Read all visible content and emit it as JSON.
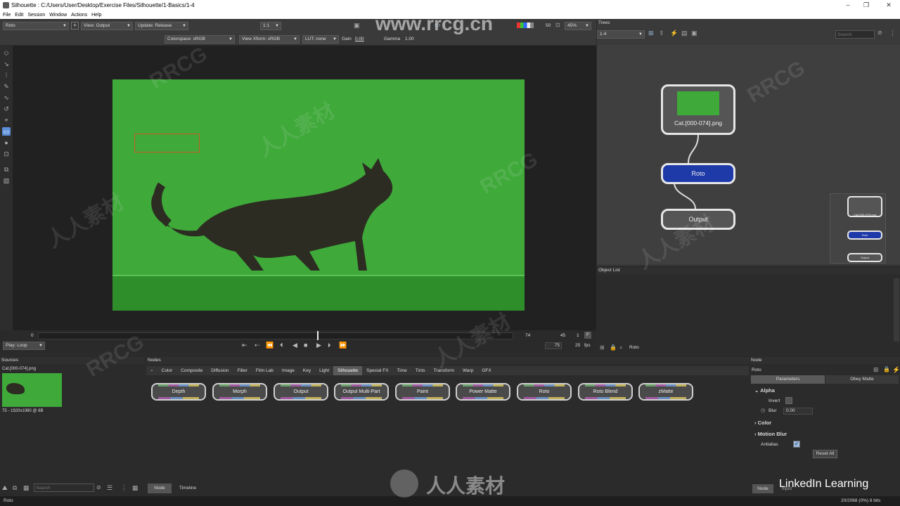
{
  "window": {
    "title": "Silhouette : C:/Users/User/Desktop/Exercise Files/Silhouette/1-Basics/1-4",
    "minimize": "–",
    "maximize": "❐",
    "close": "✕"
  },
  "menu": [
    "File",
    "Edit",
    "Session",
    "Window",
    "Actions",
    "Help"
  ],
  "toolbar": {
    "tool": "Roto",
    "view": "View: Output",
    "update": "Update: Release",
    "zoom_ratio": "1:1",
    "frame_num": "50",
    "zoom": "45%",
    "colorspace": "Colorspace: sRGB",
    "view_xform": "View Xform: sRGB",
    "lut": "LUT: none",
    "gain_label": "Gain",
    "gain_value": "0.00",
    "gamma_label": "Gamma",
    "gamma_value": "1.00"
  },
  "timeline": {
    "start": "0",
    "current": "74",
    "end": "45",
    "step": "1",
    "frame_flag": "F",
    "play_mode": "Play: Loop",
    "total": "75",
    "fps": "25",
    "fps_label": "fps"
  },
  "trees": {
    "title": "Trees",
    "selected": "1-4",
    "search_placeholder": "Search",
    "nodes": {
      "source": "Cat.[000-074].png",
      "roto": "Roto",
      "output": "Output"
    },
    "mini": {
      "source": "Cat.[000-074].png",
      "roto": "Roto",
      "output": "Output"
    }
  },
  "object_list": {
    "title": "Object List",
    "item": "Roto"
  },
  "sources": {
    "title": "Sources",
    "file": "Cat.[000-074].png",
    "info": "75 - 1920x1080 @ 8B",
    "search_placeholder": "Search"
  },
  "nodes_panel": {
    "title": "Nodes",
    "tabs": [
      "Color",
      "Composite",
      "Diffusion",
      "Filter",
      "Film Lab",
      "Image",
      "Key",
      "Light",
      "Silhouette",
      "Special FX",
      "Time",
      "Tints",
      "Transform",
      "Warp",
      "OFX"
    ],
    "active_tab": "Silhouette",
    "items": [
      "Depth",
      "Morph",
      "Output",
      "Output Multi-Part",
      "Paint",
      "Power Matte",
      "Roto",
      "Roto Blend",
      "zMatte"
    ],
    "bottom_tabs": [
      "Node",
      "Timeline"
    ]
  },
  "params": {
    "title": "Node",
    "node_name": "Roto",
    "tab_params": "Parameters",
    "tab_obey": "Obey Matte",
    "alpha": "Alpha",
    "invert": "Invert",
    "blur": "Blur",
    "blur_value": "0.00",
    "color": "Color",
    "motion_blur": "Motion Blur",
    "antialias": "Antialias",
    "reset": "Reset All",
    "node_tab": "Node",
    "input_tab": "Input"
  },
  "status": {
    "left": "Roto",
    "right": "20/2068 (0%) 8 bits"
  },
  "branding": {
    "linkedin": "LinkedIn Learning",
    "site": "www.rrcg.cn",
    "wm_cn": "人人素材",
    "wm_en": "RRCG"
  }
}
